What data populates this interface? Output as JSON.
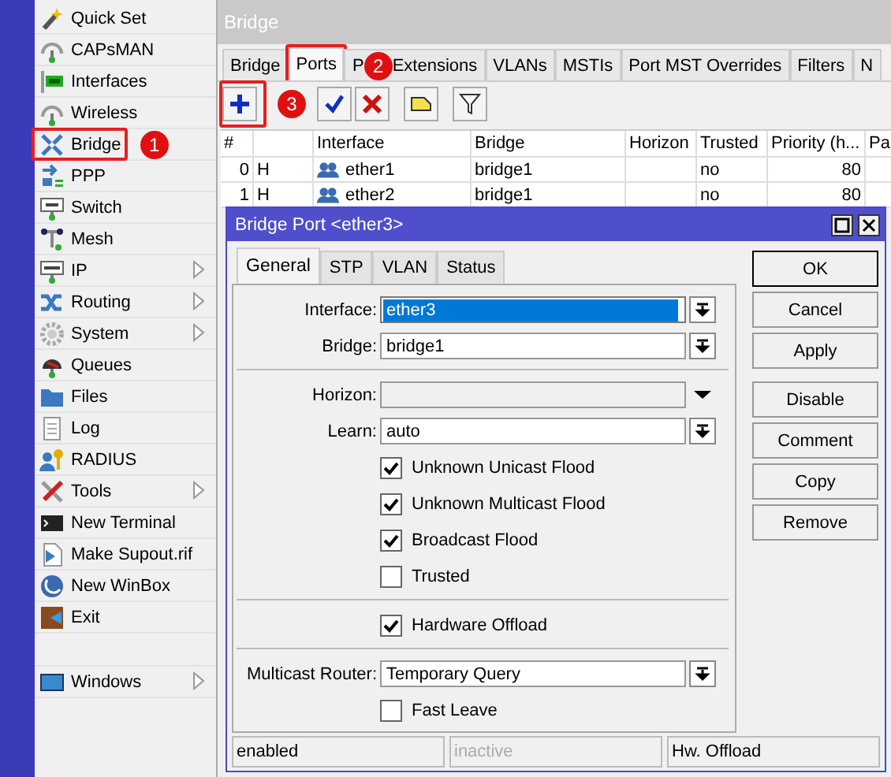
{
  "sidebar": {
    "items": [
      {
        "label": "Quick Set",
        "submenu": false
      },
      {
        "label": "CAPsMAN",
        "submenu": false
      },
      {
        "label": "Interfaces",
        "submenu": false
      },
      {
        "label": "Wireless",
        "submenu": false
      },
      {
        "label": "Bridge",
        "submenu": false
      },
      {
        "label": "PPP",
        "submenu": false
      },
      {
        "label": "Switch",
        "submenu": false
      },
      {
        "label": "Mesh",
        "submenu": false
      },
      {
        "label": "IP",
        "submenu": true
      },
      {
        "label": "Routing",
        "submenu": true
      },
      {
        "label": "System",
        "submenu": true
      },
      {
        "label": "Queues",
        "submenu": false
      },
      {
        "label": "Files",
        "submenu": false
      },
      {
        "label": "Log",
        "submenu": false
      },
      {
        "label": "RADIUS",
        "submenu": false
      },
      {
        "label": "Tools",
        "submenu": true
      },
      {
        "label": "New Terminal",
        "submenu": false
      },
      {
        "label": "Make Supout.rif",
        "submenu": false
      },
      {
        "label": "New WinBox",
        "submenu": false
      },
      {
        "label": "Exit",
        "submenu": false
      }
    ],
    "bottom_items": [
      {
        "label": "Windows",
        "submenu": true
      }
    ]
  },
  "bridge_window": {
    "title": "Bridge",
    "tabs": [
      {
        "label_parts": [
          "Bridge"
        ],
        "selected": false
      },
      {
        "label_parts": [
          "Ports"
        ],
        "selected": true
      },
      {
        "label_parts": [
          "P",
          "Extensions"
        ],
        "selected": false
      },
      {
        "label_parts": [
          "VLANs"
        ],
        "selected": false
      },
      {
        "label_parts": [
          "MSTIs"
        ],
        "selected": false
      },
      {
        "label_parts": [
          "Port MST Overrides"
        ],
        "selected": false
      },
      {
        "label_parts": [
          "Filters"
        ],
        "selected": false
      },
      {
        "label_parts": [
          "N"
        ],
        "selected": false
      }
    ],
    "table": {
      "columns": [
        "#",
        "Interface",
        "Bridge",
        "Horizon",
        "Trusted",
        "Priority (h...",
        "Pa"
      ],
      "rows": [
        {
          "number": "0",
          "flag": "H",
          "interface": "ether1",
          "bridge": "bridge1",
          "trusted": "no",
          "priority": "80"
        },
        {
          "number": "1",
          "flag": "H",
          "interface": "ether2",
          "bridge": "bridge1",
          "trusted": "no",
          "priority": "80"
        }
      ]
    }
  },
  "dialog": {
    "title": "Bridge Port <ether3>",
    "tabs": [
      {
        "label": "General",
        "selected": true
      },
      {
        "label": "STP",
        "selected": false
      },
      {
        "label": "VLAN",
        "selected": false
      },
      {
        "label": "Status",
        "selected": false
      }
    ],
    "form": [
      {
        "kind": "field",
        "label": "Interface:",
        "value": "ether3",
        "selected": true,
        "disabled": false,
        "boxed_button": true
      },
      {
        "kind": "field",
        "label": "Bridge:",
        "value": "bridge1",
        "selected": false,
        "disabled": false,
        "boxed_button": true
      },
      {
        "kind": "separator"
      },
      {
        "kind": "field",
        "label": "Horizon:",
        "selected": false,
        "disabled": true,
        "boxed_button": false
      },
      {
        "kind": "field",
        "label": "Learn:",
        "value": "auto",
        "selected": false,
        "disabled": false,
        "boxed_button": true
      },
      {
        "kind": "checkbox",
        "label": "Unknown Unicast Flood",
        "checked": true
      },
      {
        "kind": "checkbox",
        "label": "Unknown Multicast Flood",
        "checked": true
      },
      {
        "kind": "checkbox",
        "label": "Broadcast Flood",
        "checked": true
      },
      {
        "kind": "checkbox",
        "label": "Trusted",
        "checked": false
      },
      {
        "kind": "separator"
      },
      {
        "kind": "checkbox",
        "label": "Hardware Offload",
        "checked": true
      },
      {
        "kind": "separator"
      },
      {
        "kind": "field",
        "label": "Multicast Router:",
        "value": "Temporary Query",
        "selected": false,
        "disabled": false,
        "boxed_button": true
      },
      {
        "kind": "checkbox",
        "label": "Fast Leave",
        "checked": false
      }
    ],
    "button_groups": [
      [
        {
          "label": "OK",
          "default": true
        },
        {
          "label": "Cancel",
          "default": false
        },
        {
          "label": "Apply",
          "default": false
        }
      ],
      [
        {
          "label": "Disable",
          "default": false
        },
        {
          "label": "Comment",
          "default": false
        },
        {
          "label": "Copy",
          "default": false
        },
        {
          "label": "Remove",
          "default": false
        }
      ]
    ],
    "status_bar": [
      {
        "text": "enabled",
        "dimmed": false
      },
      {
        "text": "inactive",
        "dimmed": true
      },
      {
        "text": "Hw. Offload",
        "dimmed": false
      }
    ]
  },
  "annotations": [
    {
      "label": "1"
    },
    {
      "label": "2"
    },
    {
      "label": "3"
    }
  ]
}
